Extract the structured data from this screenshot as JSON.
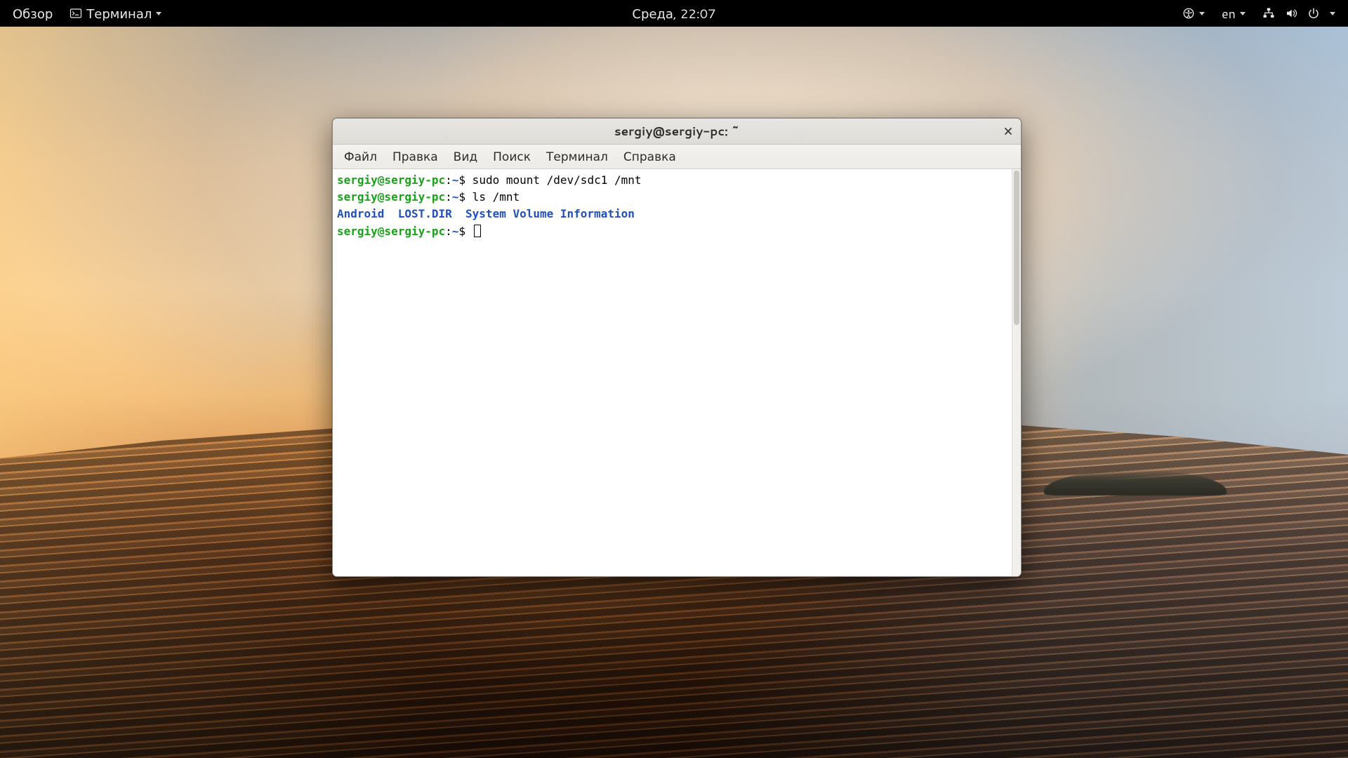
{
  "topbar": {
    "activities": "Обзор",
    "app_menu": "Терминал",
    "clock": "Среда, 22:07",
    "input_lang": "en"
  },
  "window": {
    "title": "sergiy@sergiy-pc: ~"
  },
  "menubar": {
    "file": "Файл",
    "edit": "Правка",
    "view": "Вид",
    "search": "Поиск",
    "terminal": "Терминал",
    "help": "Справка"
  },
  "terminal": {
    "prompt_user": "sergiy@sergiy-pc",
    "prompt_sep": ":",
    "prompt_path": "~",
    "prompt_sym": "$",
    "lines": [
      {
        "cmd": "sudo mount /dev/sdc1 /mnt"
      },
      {
        "cmd": "ls /mnt"
      }
    ],
    "ls_output": [
      "Android",
      "LOST.DIR",
      "System Volume Information"
    ]
  }
}
